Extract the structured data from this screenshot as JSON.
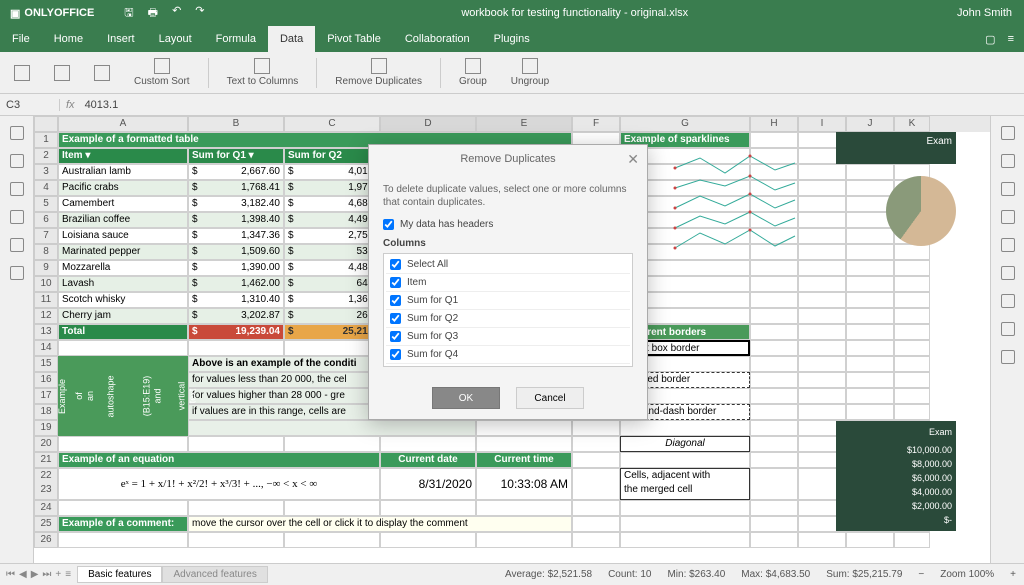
{
  "app": {
    "name": "ONLYOFFICE",
    "title": "workbook for testing functionality - original.xlsx",
    "user": "John Smith"
  },
  "menu": {
    "tabs": [
      "File",
      "Home",
      "Insert",
      "Layout",
      "Formula",
      "Data",
      "Pivot Table",
      "Collaboration",
      "Plugins"
    ],
    "active": "Data"
  },
  "ribbon": {
    "custom_sort": "Custom Sort",
    "text_to_columns": "Text to Columns",
    "remove_duplicates": "Remove Duplicates",
    "group": "Group",
    "ungroup": "Ungroup"
  },
  "formula_bar": {
    "cell": "C3",
    "value": "4013.1"
  },
  "table": {
    "title": "Example of a formatted table",
    "cols": [
      "Item",
      "Sum for Q1",
      "Sum for Q2"
    ],
    "rows": [
      {
        "item": "Australian lamb",
        "sym": "$",
        "q1": "2,667.60",
        "q2": "4,013."
      },
      {
        "item": "Pacific crabs",
        "sym": "$",
        "q1": "1,768.41",
        "q2": "1,978."
      },
      {
        "item": "Camembert",
        "sym": "$",
        "q1": "3,182.40",
        "q2": "4,683."
      },
      {
        "item": "Brazilian coffee",
        "sym": "$",
        "q1": "1,398.40",
        "q2": "4,496."
      },
      {
        "item": "Loisiana sauce",
        "sym": "$",
        "q1": "1,347.36",
        "q2": "2,750."
      },
      {
        "item": "Marinated pepper",
        "sym": "$",
        "q1": "1,509.60",
        "q2": "530."
      },
      {
        "item": "Mozzarella",
        "sym": "$",
        "q1": "1,390.00",
        "q2": "4,488."
      },
      {
        "item": "Lavash",
        "sym": "$",
        "q1": "1,462.00",
        "q2": "644."
      },
      {
        "item": "Scotch whisky",
        "sym": "$",
        "q1": "1,310.40",
        "q2": "1,368."
      },
      {
        "item": "Cherry jam",
        "sym": "$",
        "q1": "3,202.87",
        "q2": "263."
      }
    ],
    "total": {
      "label": "Total",
      "sym": "$",
      "q1": "19,239.04",
      "q2": "25,215."
    }
  },
  "autoshape": {
    "l1": "Example",
    "l2": "of an",
    "l3": "autoshape",
    "l4": "(B15:E19) and",
    "l5": "vertical text"
  },
  "cond": {
    "title": "Above is an example of the conditi",
    "l1": "for values less than 20 000, the cel",
    "l2": "for values higher than 28 000 - gre",
    "l3": "if values are in this range, cells are"
  },
  "equation": {
    "title": "Example of an equation",
    "date_lbl": "Current date",
    "time_lbl": "Current time",
    "date": "8/31/2020",
    "time": "10:33:08 AM",
    "formula": "eˣ = 1 + x/1! + x²/2! + x³/3! + ..., −∞ < x < ∞"
  },
  "comment": {
    "title": "Example of a comment:",
    "text": "move the cursor over the cell or click it to display the comment"
  },
  "sparklines": {
    "title": "Example of sparklines"
  },
  "borders": {
    "title": "Different borders",
    "thick": "Thick box border",
    "dashed": "Dashed border",
    "dotdash": "Dot-and-dash border",
    "diagonal": "Diagonal",
    "merged1": "Cells, adjacent with",
    "merged2": "the merged cell"
  },
  "darkpanel": {
    "exam": "Exam",
    "rows": [
      "$10,000.00",
      "$8,000.00",
      "$6,000.00",
      "$4,000.00",
      "$2,000.00",
      "$-"
    ]
  },
  "tabs": {
    "t1": "Basic features",
    "t2": "Advanced features"
  },
  "status": {
    "avg": "Average: $2,521.58",
    "count": "Count: 10",
    "min": "Min: $263.40",
    "max": "Max: $4,683.50",
    "sum": "Sum: $25,215.79",
    "zoom": "Zoom 100%"
  },
  "dialog": {
    "title": "Remove Duplicates",
    "desc": "To delete duplicate values, select one or more columns that contain duplicates.",
    "headers_chk": "My data has headers",
    "columns_lbl": "Columns",
    "options": [
      "Select All",
      "Item",
      "Sum for Q1",
      "Sum for Q2",
      "Sum for Q3",
      "Sum for Q4"
    ],
    "ok": "OK",
    "cancel": "Cancel"
  }
}
